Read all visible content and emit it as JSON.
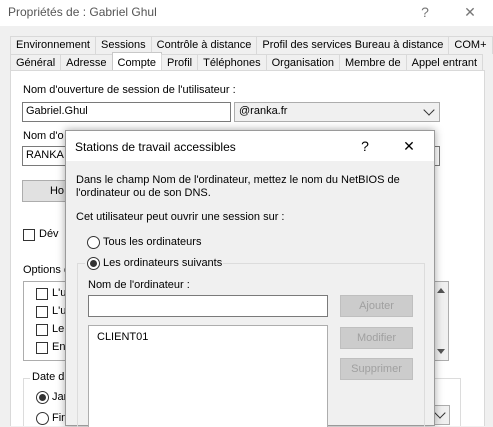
{
  "window": {
    "title": "Propriétés de : Gabriel Ghul",
    "help_glyph": "?",
    "close_glyph": "✕"
  },
  "tabs_row1": [
    "Environnement",
    "Sessions",
    "Contrôle à distance",
    "Profil des services Bureau à distance",
    "COM+"
  ],
  "tabs_row2": [
    "Général",
    "Adresse",
    "Compte",
    "Profil",
    "Téléphones",
    "Organisation",
    "Membre de",
    "Appel entrant"
  ],
  "active_tab": "Compte",
  "account": {
    "logon_label": "Nom d'ouverture de session de l'utilisateur :",
    "logon_value": "Gabriel.Ghul",
    "domain_value": "@ranka.fr",
    "prewin_label_partial": "Nom d'o",
    "prewin_value_partial": "RANKA",
    "hours_button_partial": "Ho",
    "unlock_partial": "Dév",
    "options_label_partial": "Options d",
    "options_items_partial": [
      "L'u",
      "L'u",
      "Le",
      "En"
    ],
    "expiry_label_partial": "Date d",
    "expiry_opt1_partial": "Jan",
    "expiry_opt2_partial": "Fin"
  },
  "dialog": {
    "title": "Stations de travail accessibles",
    "help_glyph": "?",
    "close_glyph": "✕",
    "description_line1": "Dans le champ Nom de l'ordinateur, mettez le nom du NetBIOS de",
    "description_line2": "l'ordinateur ou de son DNS.",
    "logon_to_label": "Cet utilisateur peut ouvrir une session sur :",
    "radio_all": "Tous les ordinateurs",
    "radio_following": "Les ordinateurs suivants",
    "computer_name_label": "Nom de l'ordinateur :",
    "computer_name_value": "",
    "add_button": "Ajouter",
    "edit_button": "Modifier",
    "remove_button": "Supprimer",
    "computers": [
      "CLIENT01"
    ]
  }
}
